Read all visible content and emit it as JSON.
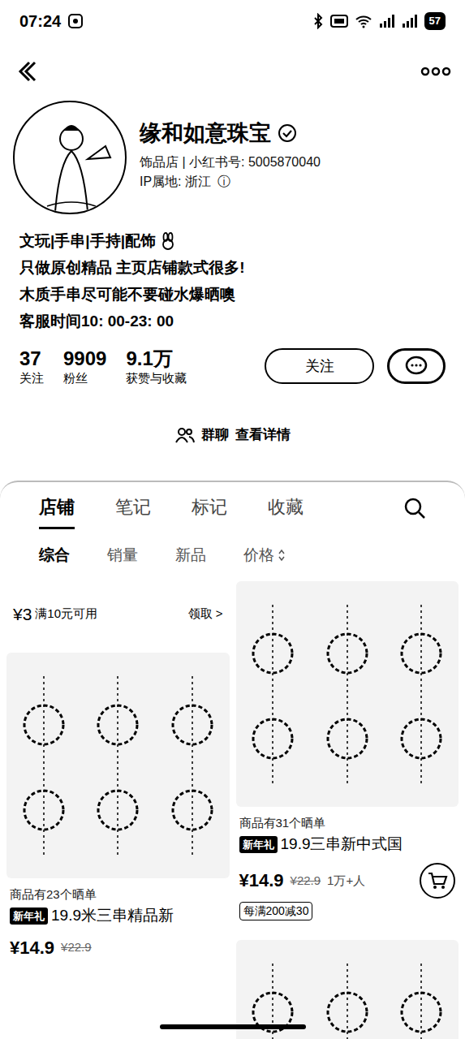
{
  "status_bar": {
    "time": "07:24",
    "battery": "57"
  },
  "profile": {
    "name": "缘和如意珠宝",
    "verified": true,
    "account_line": "饰品店 | 小红书号: 5005870040",
    "ip_line": "IP属地: 浙江",
    "ip_info": "ⓘ",
    "bio": [
      "文玩|手串|手持|配饰",
      "只做原创精品 主页店铺款式很多!",
      "木质手串尽可能不要碰水爆晒噢",
      "客服时间10: 00-23: 00"
    ]
  },
  "stats": [
    {
      "value": "37",
      "label": "关注"
    },
    {
      "value": "9909",
      "label": "粉丝"
    },
    {
      "value": "9.1万",
      "label": "获赞与收藏"
    }
  ],
  "follow_button": "关注",
  "group_chat": {
    "label": "群聊",
    "link": "查看详情"
  },
  "tabs": [
    {
      "label": "店铺",
      "selected": true
    },
    {
      "label": "笔记",
      "selected": false
    },
    {
      "label": "标记",
      "selected": false
    },
    {
      "label": "收藏",
      "selected": false
    }
  ],
  "sort": [
    {
      "label": "综合",
      "selected": true,
      "sortable": false
    },
    {
      "label": "销量",
      "selected": false,
      "sortable": false
    },
    {
      "label": "新品",
      "selected": false,
      "sortable": false
    },
    {
      "label": "价格",
      "selected": false,
      "sortable": true
    }
  ],
  "columns": [
    {
      "items": [
        {
          "kind": "coupon",
          "amount": "¥3",
          "condition": "满10元可用",
          "action": "领取 >"
        },
        {
          "kind": "product",
          "reviews": "商品有23个晒单",
          "tag": "新年礼",
          "title": "19.9米三串精品新",
          "price": "¥14.9",
          "original_price": "¥22.9"
        }
      ]
    },
    {
      "items": [
        {
          "kind": "product",
          "reviews": "商品有31个晒单",
          "tag": "新年礼",
          "title": "19.9三串新中式国",
          "price": "¥14.9",
          "original_price": "¥22.9",
          "sales": "1万+人",
          "promo": "每满200减30",
          "cart": true
        },
        {
          "kind": "image"
        }
      ]
    }
  ]
}
